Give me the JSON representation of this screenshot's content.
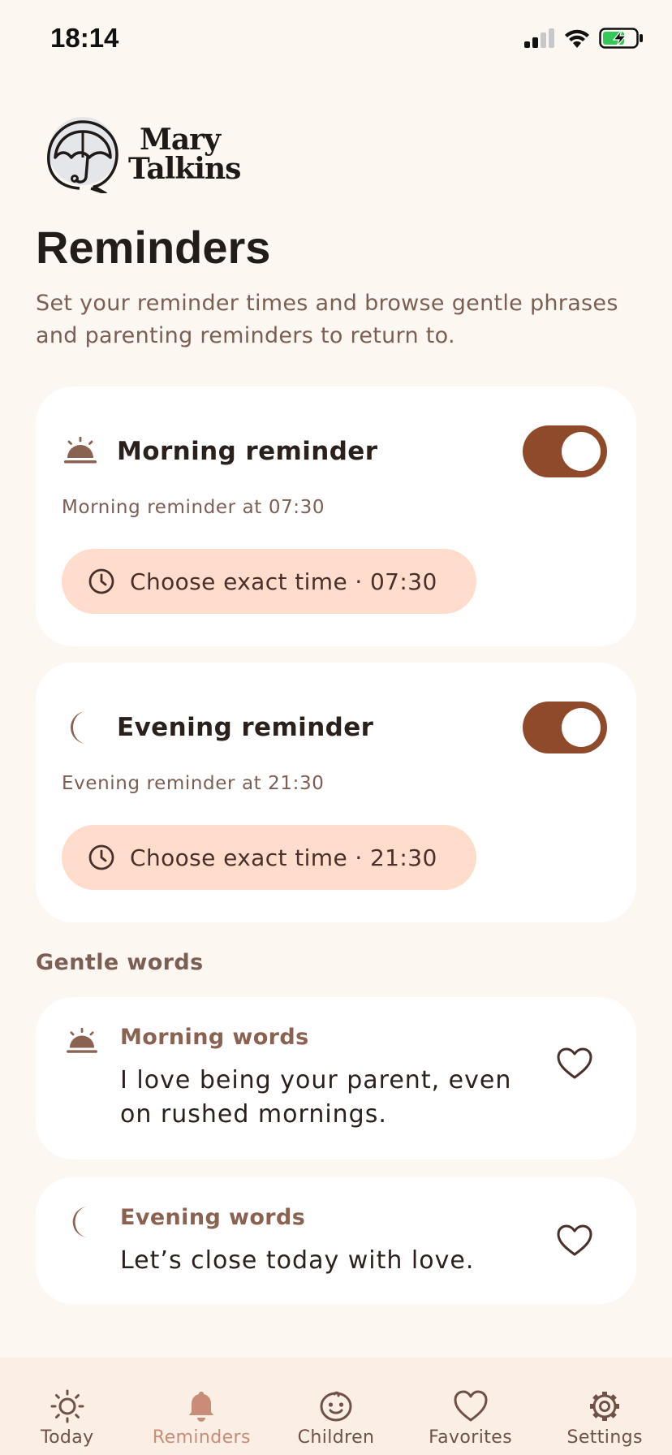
{
  "status_bar": {
    "time": "18:14"
  },
  "brand": {
    "line1": "Mary",
    "line2": "Talkins"
  },
  "page": {
    "title": "Reminders",
    "subtitle": "Set your reminder times and browse gentle phrases and parenting reminders to return to."
  },
  "reminders": [
    {
      "icon": "sunrise-icon",
      "title": "Morning reminder",
      "enabled": true,
      "description": "Morning reminder at 07:30",
      "button_label": "Choose exact time · 07:30"
    },
    {
      "icon": "moon-icon",
      "title": "Evening reminder",
      "enabled": true,
      "description": "Evening reminder at 21:30",
      "button_label": "Choose exact time · 21:30"
    }
  ],
  "gentle_words": {
    "heading": "Gentle words",
    "items": [
      {
        "icon": "sunrise-icon",
        "title": "Morning words",
        "text": "I love being your parent, even on rushed mornings.",
        "favorited": false
      },
      {
        "icon": "moon-icon",
        "title": "Evening words",
        "text": "Let’s close today with love.",
        "favorited": false
      }
    ]
  },
  "tab_bar": {
    "active": "Reminders",
    "tabs": [
      {
        "label": "Today",
        "icon": "sun-icon"
      },
      {
        "label": "Reminders",
        "icon": "bell-icon"
      },
      {
        "label": "Children",
        "icon": "baby-face-icon"
      },
      {
        "label": "Favorites",
        "icon": "heart-icon"
      },
      {
        "label": "Settings",
        "icon": "gear-icon"
      }
    ]
  },
  "colors": {
    "background": "#fdf7f2",
    "accent": "#8f4a2c",
    "button_fill": "#ffdccb",
    "muted_text": "#7b5e54",
    "active_tab": "#c88d78"
  }
}
